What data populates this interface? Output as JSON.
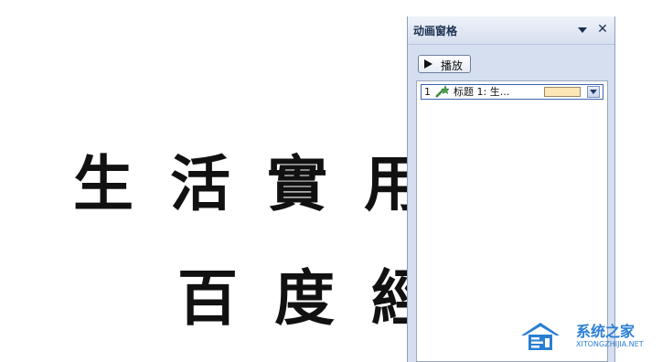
{
  "slide": {
    "line1": "生活實用節",
    "line2": "百度經"
  },
  "animation_pane": {
    "title": "动画窗格",
    "menu_icon": "triangle-down-icon",
    "close_icon": "close-icon",
    "close_glyph": "✕",
    "play_button": {
      "label": "播放",
      "icon": "play-icon"
    },
    "items": [
      {
        "index": "1",
        "icon": "animation-effect-star-icon",
        "label": "标题 1: 生...",
        "timing_color": "#fde6b6",
        "dropdown_icon": "chevron-down-icon"
      }
    ]
  },
  "watermark": {
    "brand_cn": "系统之家",
    "brand_en": "XITONGZHIJIA.NET"
  },
  "colors": {
    "pane_bg": "#d6dff0",
    "selection_border": "#3b64b4",
    "watermark_blue": "#2a7fd4"
  }
}
